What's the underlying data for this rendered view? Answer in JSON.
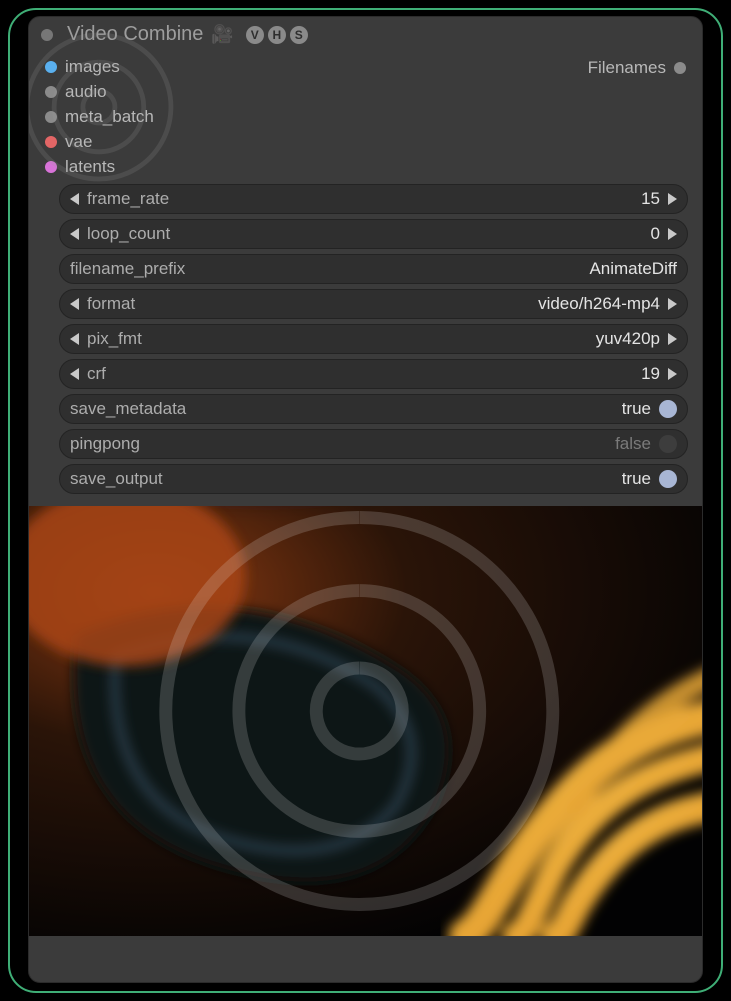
{
  "node": {
    "title": "Video Combine",
    "badges": [
      "V",
      "H",
      "S"
    ]
  },
  "inputs": [
    {
      "name": "images",
      "color": "socket-images"
    },
    {
      "name": "audio",
      "color": "socket-audio"
    },
    {
      "name": "meta_batch",
      "color": "socket-meta"
    },
    {
      "name": "vae",
      "color": "socket-vae"
    },
    {
      "name": "latents",
      "color": "socket-latents"
    }
  ],
  "outputs": [
    {
      "name": "Filenames"
    }
  ],
  "widgets": {
    "frame_rate": {
      "label": "frame_rate",
      "value": "15"
    },
    "loop_count": {
      "label": "loop_count",
      "value": "0"
    },
    "filename_prefix": {
      "label": "filename_prefix",
      "value": "AnimateDiff"
    },
    "format": {
      "label": "format",
      "value": "video/h264-mp4"
    },
    "pix_fmt": {
      "label": "pix_fmt",
      "value": "yuv420p"
    },
    "crf": {
      "label": "crf",
      "value": "19"
    },
    "save_metadata": {
      "label": "save_metadata",
      "value": "true",
      "on": true
    },
    "pingpong": {
      "label": "pingpong",
      "value": "false",
      "on": false
    },
    "save_output": {
      "label": "save_output",
      "value": "true",
      "on": true
    }
  }
}
